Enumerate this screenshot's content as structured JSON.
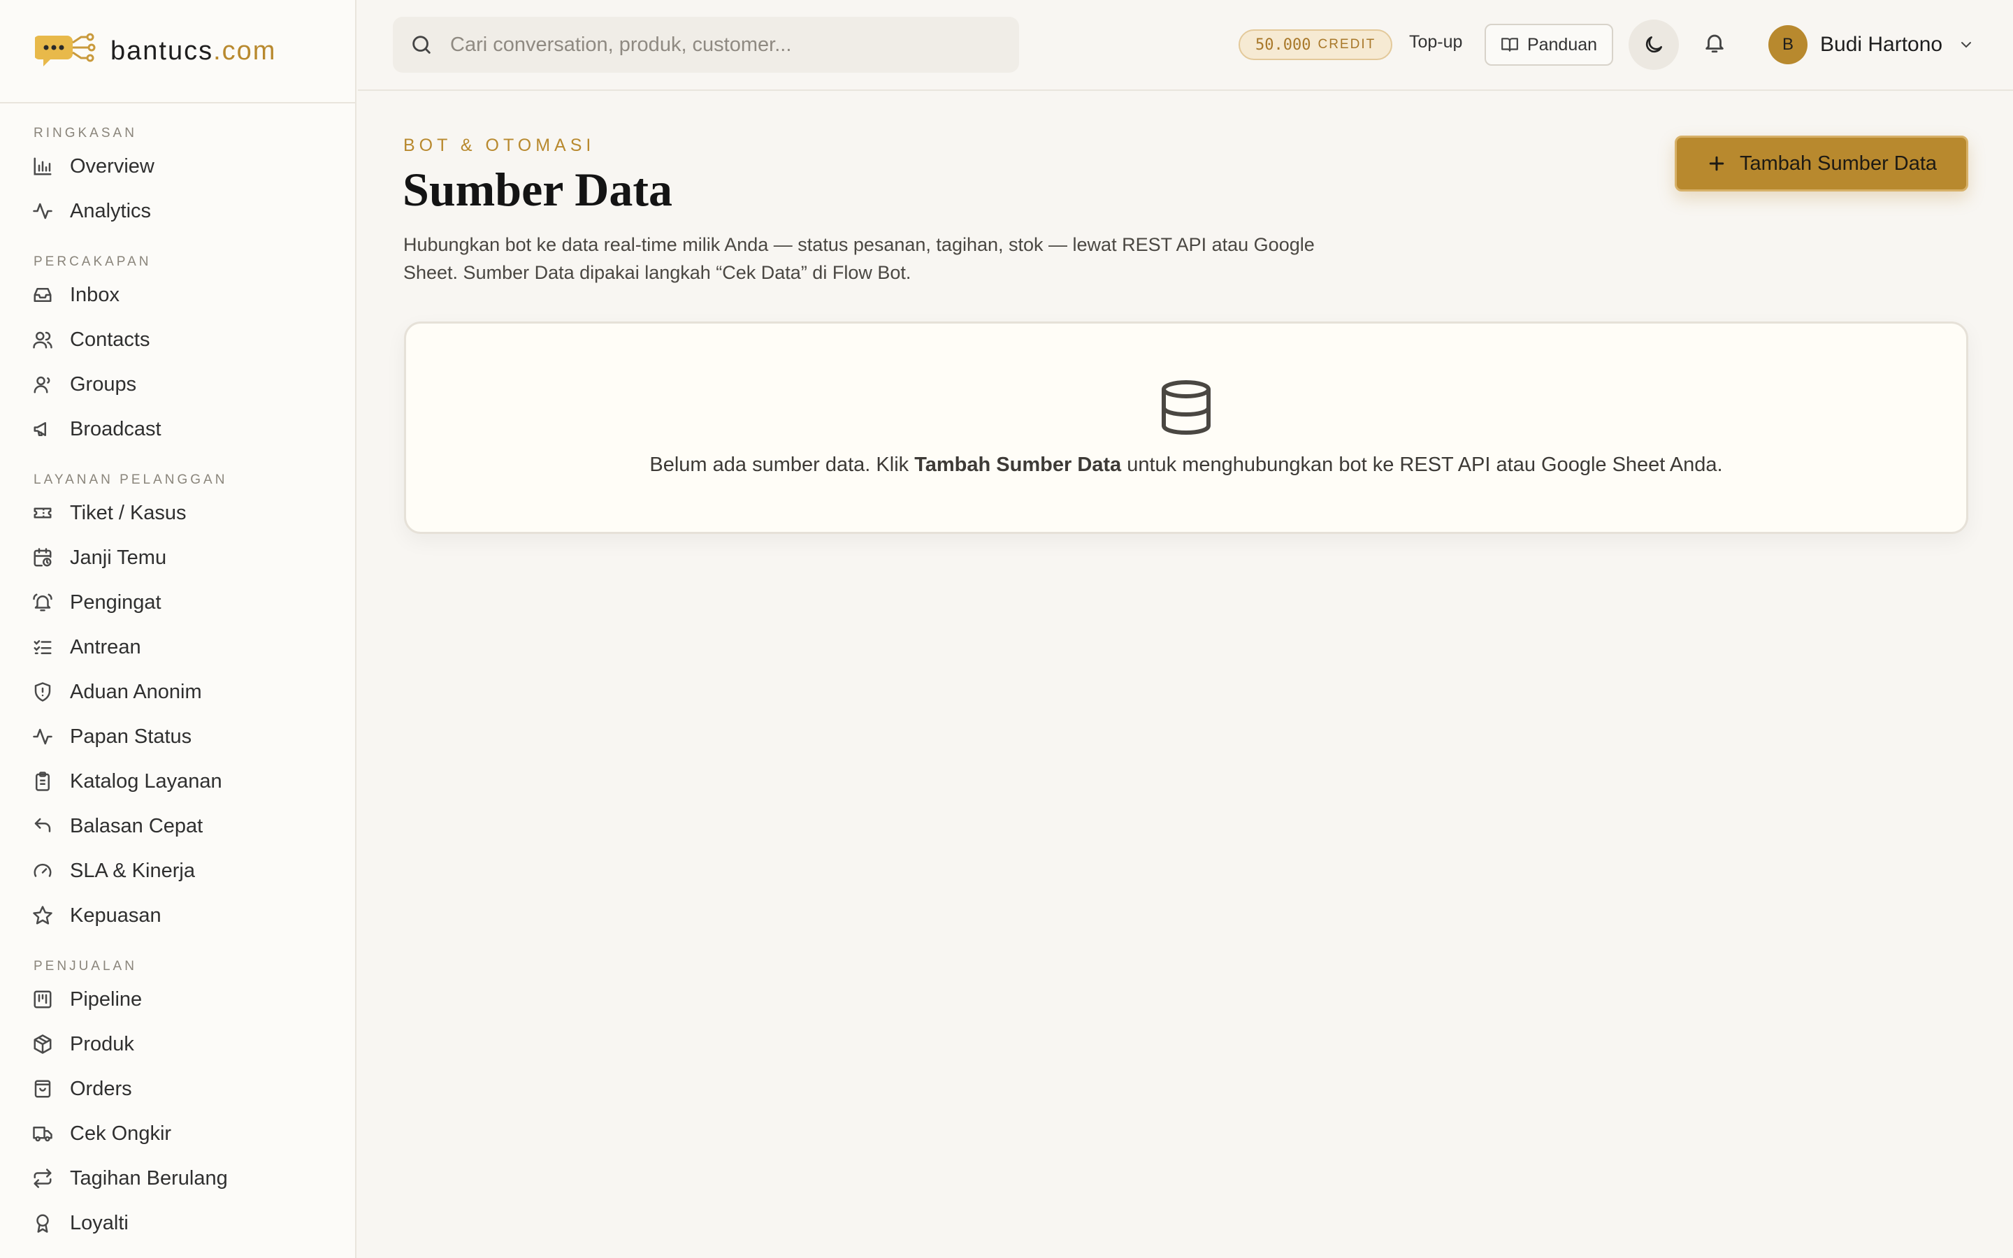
{
  "brand": {
    "name": "bantucs",
    "suffix": ".com",
    "accent": "#b8892e"
  },
  "sidebar": {
    "sections": [
      {
        "title": "RINGKASAN",
        "items": [
          {
            "label": "Overview",
            "icon": "bar-chart-icon"
          },
          {
            "label": "Analytics",
            "icon": "activity-icon"
          }
        ]
      },
      {
        "title": "PERCAKAPAN",
        "items": [
          {
            "label": "Inbox",
            "icon": "inbox-icon"
          },
          {
            "label": "Contacts",
            "icon": "users-icon"
          },
          {
            "label": "Groups",
            "icon": "group-icon"
          },
          {
            "label": "Broadcast",
            "icon": "megaphone-icon"
          }
        ]
      },
      {
        "title": "LAYANAN PELANGGAN",
        "items": [
          {
            "label": "Tiket / Kasus",
            "icon": "ticket-icon"
          },
          {
            "label": "Janji Temu",
            "icon": "calendar-clock-icon"
          },
          {
            "label": "Pengingat",
            "icon": "bell-ring-icon"
          },
          {
            "label": "Antrean",
            "icon": "list-checks-icon"
          },
          {
            "label": "Aduan Anonim",
            "icon": "shield-alert-icon"
          },
          {
            "label": "Papan Status",
            "icon": "activity-icon"
          },
          {
            "label": "Katalog Layanan",
            "icon": "clipboard-list-icon"
          },
          {
            "label": "Balasan Cepat",
            "icon": "reply-icon"
          },
          {
            "label": "SLA & Kinerja",
            "icon": "gauge-icon"
          },
          {
            "label": "Kepuasan",
            "icon": "star-icon"
          }
        ]
      },
      {
        "title": "PENJUALAN",
        "items": [
          {
            "label": "Pipeline",
            "icon": "kanban-icon"
          },
          {
            "label": "Produk",
            "icon": "package-icon"
          },
          {
            "label": "Orders",
            "icon": "shopping-bag-icon"
          },
          {
            "label": "Cek Ongkir",
            "icon": "truck-icon"
          },
          {
            "label": "Tagihan Berulang",
            "icon": "repeat-icon"
          },
          {
            "label": "Loyalti",
            "icon": "award-icon"
          }
        ]
      }
    ]
  },
  "header": {
    "search_placeholder": "Cari conversation, produk, customer...",
    "credit_amount": "50.000",
    "credit_unit": "CREDIT",
    "topup_label": "Top-up",
    "guide_label": "Panduan",
    "user_initial": "B",
    "user_name": "Budi Hartono"
  },
  "main": {
    "eyebrow": "BOT & OTOMASI",
    "title": "Sumber Data",
    "description": "Hubungkan bot ke data real-time milik Anda — status pesanan, tagihan, stok — lewat REST API atau Google Sheet. Sumber Data dipakai langkah “Cek Data” di Flow Bot.",
    "add_button_label": "Tambah Sumber Data",
    "empty": {
      "before": "Belum ada sumber data. Klik ",
      "strong": "Tambah Sumber Data",
      "after": " untuk menghubungkan bot ke REST API atau Google Sheet Anda."
    }
  }
}
